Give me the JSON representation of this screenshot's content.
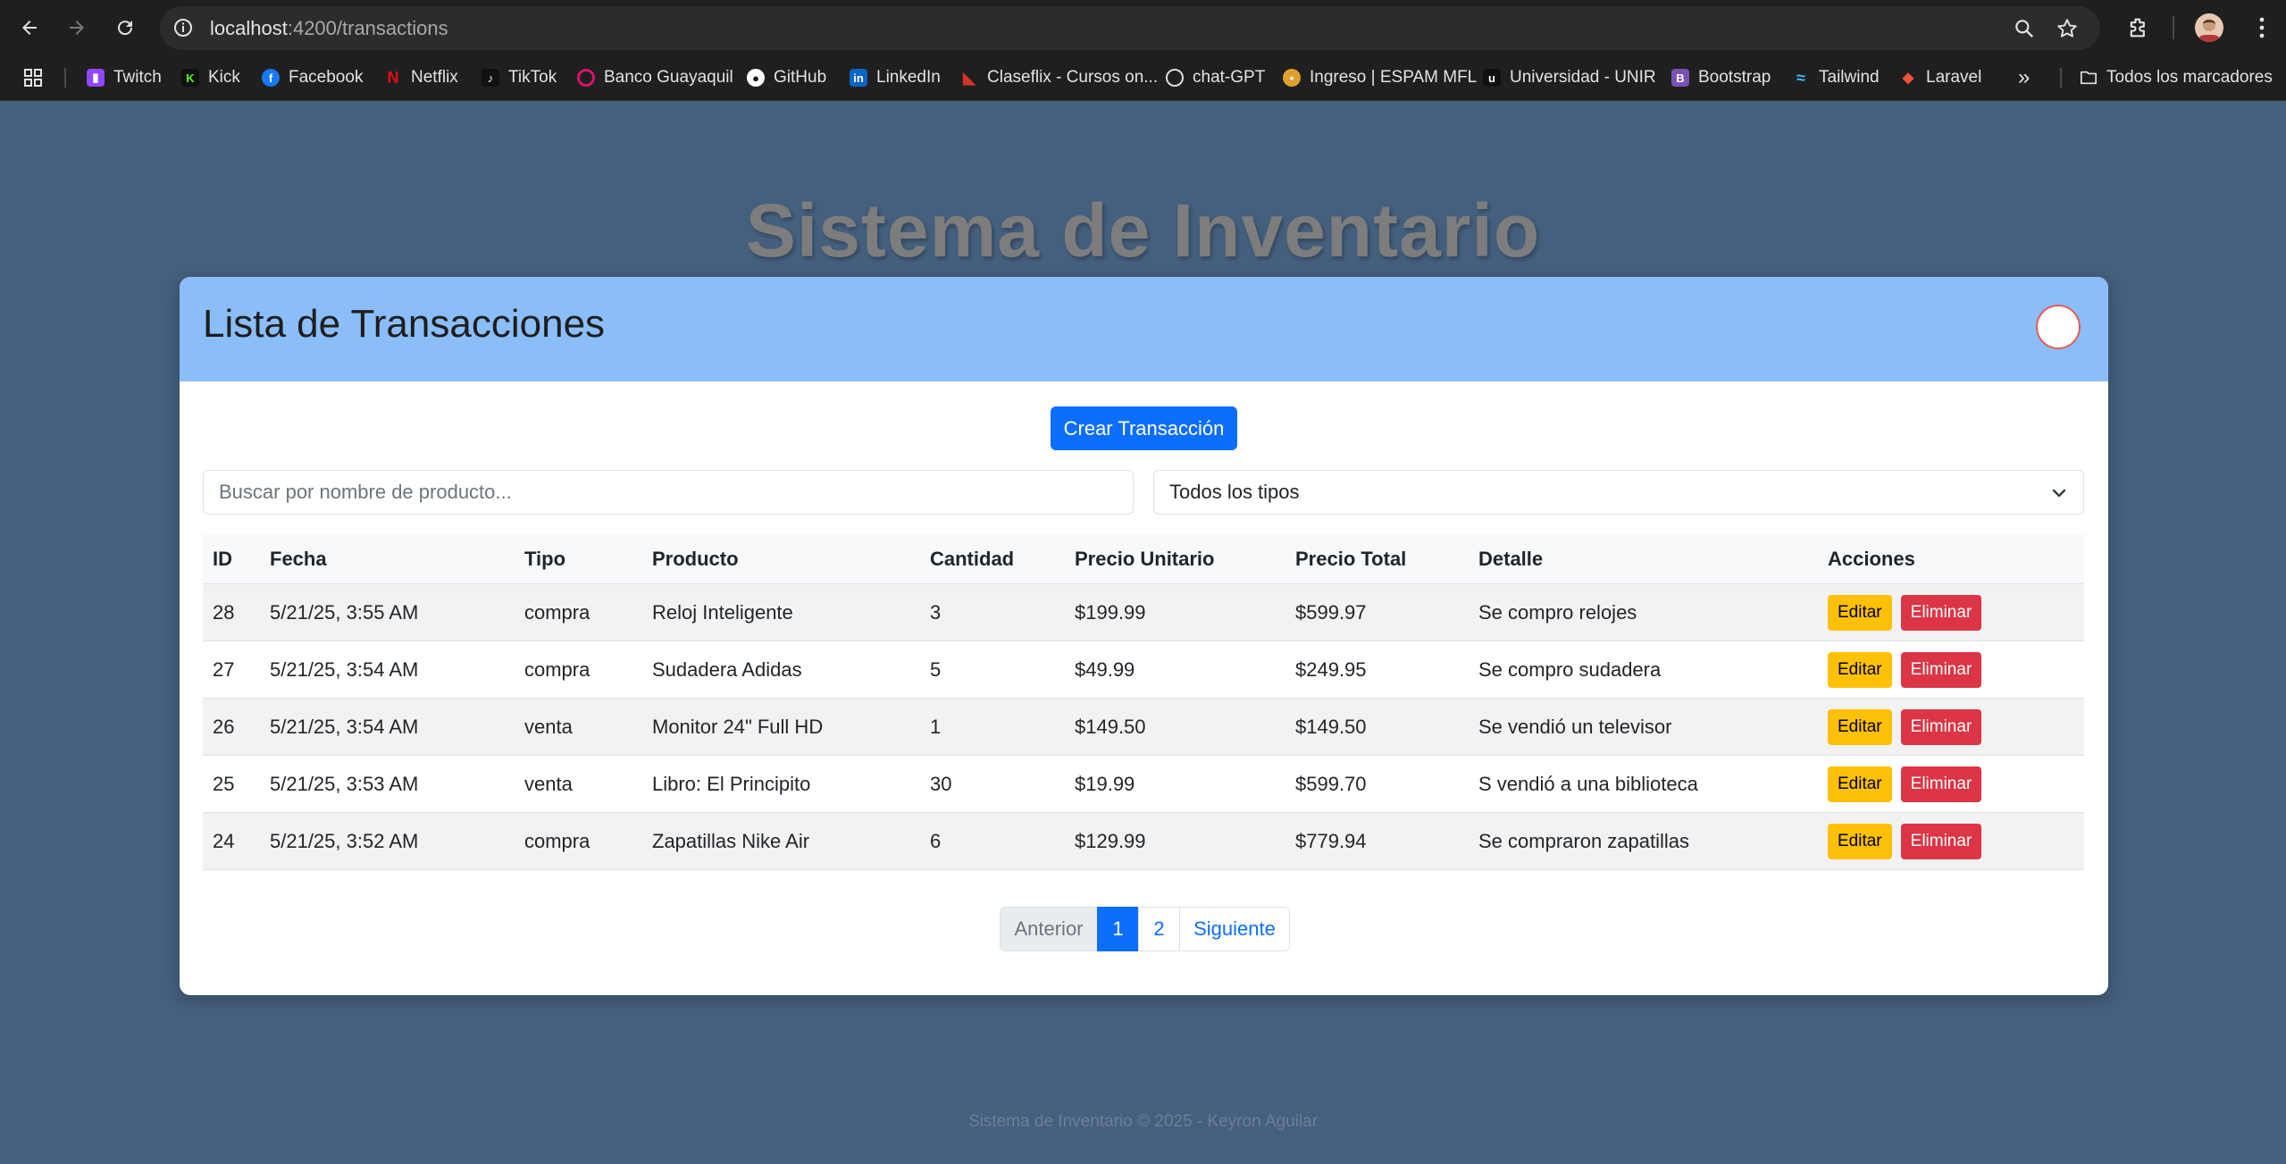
{
  "browser": {
    "url_host": "localhost",
    "url_path": ":4200/transactions",
    "bookmarks": [
      {
        "label": "Twitch",
        "color": "#9146ff"
      },
      {
        "label": "Kick",
        "color": "#53fc18"
      },
      {
        "label": "Facebook",
        "color": "#1877f2"
      },
      {
        "label": "Netflix",
        "color": "#e50914"
      },
      {
        "label": "TikTok",
        "color": "#111111"
      },
      {
        "label": "Banco Guayaquil",
        "color": "#d6136e"
      },
      {
        "label": "GitHub",
        "color": "#ffffff"
      },
      {
        "label": "LinkedIn",
        "color": "#0a66c2"
      },
      {
        "label": "Claseflix - Cursos on...",
        "color": "#d0352f"
      },
      {
        "label": "chat-GPT",
        "color": "#dddddd"
      },
      {
        "label": "Ingreso | ESPAM MFL",
        "color": "#e0a030"
      },
      {
        "label": "Universidad - UNIR",
        "color": "#111111"
      },
      {
        "label": "Bootstrap",
        "color": "#7952b3"
      },
      {
        "label": "Tailwind",
        "color": "#38bdf8"
      },
      {
        "label": "Laravel",
        "color": "#f05340"
      }
    ],
    "all_bookmarks_label": "Todos los marcadores"
  },
  "page": {
    "hero_title": "Sistema de Inventario",
    "card_title": "Lista de Transacciones",
    "create_button": "Crear Transacción",
    "search_placeholder": "Buscar por nombre de producto...",
    "type_filter_value": "Todos los tipos",
    "footer": "Sistema de Inventario © 2025 - Keyron Aguilar"
  },
  "table": {
    "headers": [
      "ID",
      "Fecha",
      "Tipo",
      "Producto",
      "Cantidad",
      "Precio Unitario",
      "Precio Total",
      "Detalle",
      "Acciones"
    ],
    "rows": [
      {
        "id": "28",
        "fecha": "5/21/25, 3:55 AM",
        "tipo": "compra",
        "producto": "Reloj Inteligente",
        "cantidad": "3",
        "precio_unitario": "$199.99",
        "precio_total": "$599.97",
        "detalle": "Se compro relojes"
      },
      {
        "id": "27",
        "fecha": "5/21/25, 3:54 AM",
        "tipo": "compra",
        "producto": "Sudadera Adidas",
        "cantidad": "5",
        "precio_unitario": "$49.99",
        "precio_total": "$249.95",
        "detalle": "Se compro sudadera"
      },
      {
        "id": "26",
        "fecha": "5/21/25, 3:54 AM",
        "tipo": "venta",
        "producto": "Monitor 24\" Full HD",
        "cantidad": "1",
        "precio_unitario": "$149.50",
        "precio_total": "$149.50",
        "detalle": "Se vendió un televisor"
      },
      {
        "id": "25",
        "fecha": "5/21/25, 3:53 AM",
        "tipo": "venta",
        "producto": "Libro: El Principito",
        "cantidad": "30",
        "precio_unitario": "$19.99",
        "precio_total": "$599.70",
        "detalle": "S vendió a una biblioteca"
      },
      {
        "id": "24",
        "fecha": "5/21/25, 3:52 AM",
        "tipo": "compra",
        "producto": "Zapatillas Nike Air",
        "cantidad": "6",
        "precio_unitario": "$129.99",
        "precio_total": "$779.94",
        "detalle": "Se compraron zapatillas"
      }
    ],
    "edit_label": "Editar",
    "delete_label": "Eliminar"
  },
  "pagination": {
    "prev": "Anterior",
    "pages": [
      "1",
      "2"
    ],
    "current": "1",
    "next": "Siguiente"
  }
}
